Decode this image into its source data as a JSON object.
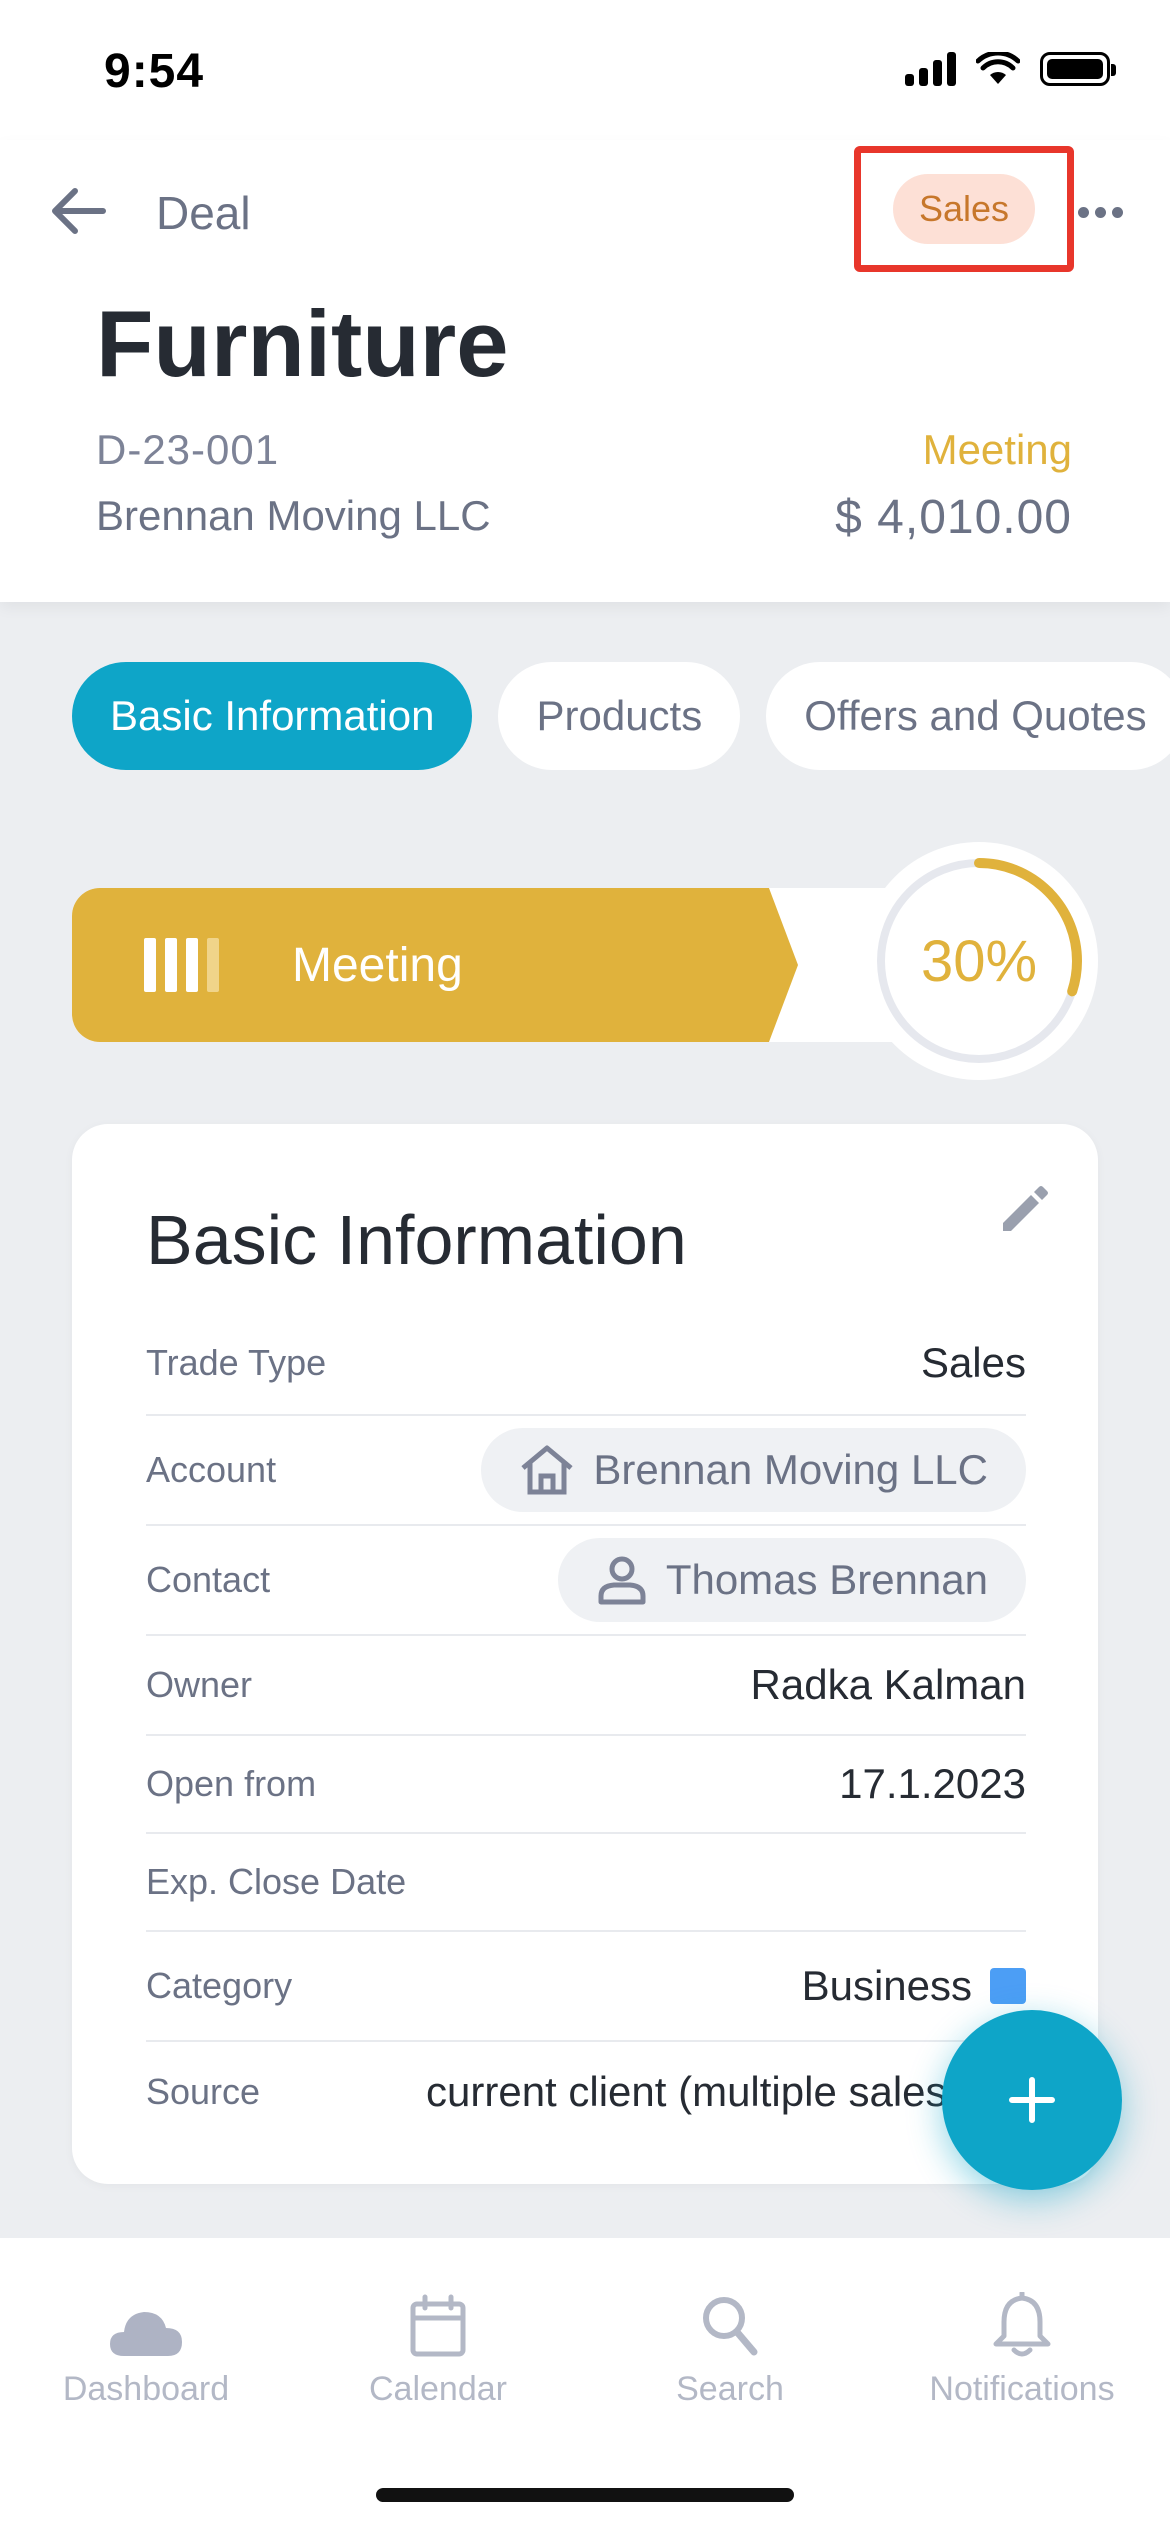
{
  "status_bar": {
    "time": "9:54"
  },
  "header": {
    "back_label": "Deal",
    "trade_badge": "Sales",
    "title": "Furniture",
    "code": "D-23-001",
    "account": "Brennan Moving LLC",
    "stage": "Meeting",
    "amount": "$ 4,010.00"
  },
  "tabs": [
    {
      "label": "Basic Information",
      "active": true
    },
    {
      "label": "Products",
      "active": false
    },
    {
      "label": "Offers and Quotes",
      "active": false
    }
  ],
  "stage_bar": {
    "label": "Meeting",
    "progress_text": "30%",
    "progress": 0.3
  },
  "card": {
    "title": "Basic Information",
    "rows": [
      {
        "label": "Trade Type",
        "value": "Sales"
      },
      {
        "label": "Account",
        "value": "Brennan Moving LLC"
      },
      {
        "label": "Contact",
        "value": "Thomas Brennan"
      },
      {
        "label": "Owner",
        "value": "Radka Kalman"
      },
      {
        "label": "Open from",
        "value": "17.1.2023"
      },
      {
        "label": "Exp. Close Date",
        "value": ""
      },
      {
        "label": "Category",
        "value": "Business"
      },
      {
        "label": "Source",
        "value": "current client (multiple sales)"
      }
    ]
  },
  "bottom_nav": [
    {
      "label": "Dashboard",
      "icon": "cloud-icon"
    },
    {
      "label": "Calendar",
      "icon": "calendar-icon"
    },
    {
      "label": "Search",
      "icon": "search-icon"
    },
    {
      "label": "Notifications",
      "icon": "bell-icon"
    }
  ],
  "colors": {
    "accent": "#0ea5c8",
    "stage": "#e0b23c",
    "badge_bg": "#fde0d6",
    "badge_text": "#c7772b",
    "category": "#4c9ef5",
    "highlight_box": "#e8362b"
  }
}
